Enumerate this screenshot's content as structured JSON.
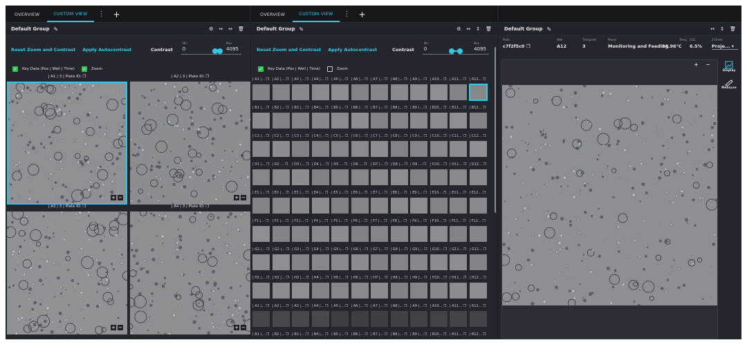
{
  "panels": [
    {
      "tabs": [
        {
          "label": "OVERVIEW"
        },
        {
          "label": "CUSTOM VIEW"
        }
      ],
      "tab_menu": "⋮",
      "tab_add": "+",
      "group_title": "Default Group",
      "reset_label": "Reset Zoom and Contrast",
      "autocontrast_label": "Apply Autocontrast",
      "contrast_label": "Contrast",
      "min_label": "Min",
      "max_label": "Max",
      "min_value": "0",
      "max_value": "4095",
      "key_data_label": "Key Data (Pos | Well | Time)",
      "zoom_label": "Zoom",
      "key_data_checked": true,
      "zoom_checked": true,
      "wells": [
        {
          "label": "| A1 | 3 | Plate ID: ",
          "selected": true
        },
        {
          "label": "| A2 | 3 | Plate ID: ",
          "selected": false
        },
        {
          "label": "| A3 | 3 | Plate ID: ",
          "selected": false
        },
        {
          "label": "| A4 | 3 | Plate ID: ",
          "selected": false
        }
      ],
      "zoom_in": "+",
      "zoom_out": "−"
    },
    {
      "tabs": [
        {
          "label": "OVERVIEW"
        },
        {
          "label": "CUSTOM VIEW"
        }
      ],
      "tab_menu": "⋮",
      "tab_add": "+",
      "group_title": "Default Group",
      "reset_label": "Reset Zoom and Contrast",
      "autocontrast_label": "Apply Autocontrast",
      "contrast_label": "Contrast",
      "min_label": "Min",
      "max_label": "Max",
      "min_value": "0",
      "max_value": "4095",
      "key_data_label": "Key Data (Pos | Well | Time)",
      "zoom_label": "Zoom",
      "key_data_checked": true,
      "zoom_checked": false,
      "rows": [
        {
          "labels": [
            "| A1 |...",
            "| A2 |...",
            "| A3 |...",
            "| A4 |...",
            "| A5 |...",
            "| A6 |...",
            "| A7 |...",
            "| A8 |...",
            "| A9 |...",
            "| A10...",
            "| A11...",
            "| A12..."
          ],
          "dark": false,
          "sel": 11
        },
        {
          "labels": [
            "| B1 |...",
            "| B2 |...",
            "| B3 |...",
            "| B4 |...",
            "| B5 |...",
            "| B6 |...",
            "| B7 |...",
            "| B8 |...",
            "| B9 |...",
            "| B10...",
            "| B11...",
            "| B12..."
          ],
          "dark": false,
          "sel": -1
        },
        {
          "labels": [
            "| C1 |...",
            "| C2 |...",
            "| C3 |...",
            "| C4 |...",
            "| C5 |...",
            "| C6 |...",
            "| C7 |...",
            "| C8 |...",
            "| C9 |...",
            "| C10...",
            "| C11...",
            "| C12..."
          ],
          "dark": false,
          "sel": -1
        },
        {
          "labels": [
            "| D1 |...",
            "| D2 ...",
            "| D3 |...",
            "| D4 |...",
            "| D5 ...",
            "| D6 ...",
            "| D7 |...",
            "| D8 |...",
            "| D9 ...",
            "| D10...",
            "| D11...",
            "| D12..."
          ],
          "dark": false,
          "sel": -1
        },
        {
          "labels": [
            "| E1 |...",
            "| E2 |...",
            "| E3 |...",
            "| E4 |...",
            "| E5 |...",
            "| E6 |...",
            "| E7 |...",
            "| E8 |...",
            "| E9 |...",
            "| E10...",
            "| E11...",
            "| E12..."
          ],
          "dark": false,
          "sel": -1
        },
        {
          "labels": [
            "| F1 |...",
            "| F2 |...",
            "| F3 |...",
            "| F4 |...",
            "| F5 |...",
            "| F6 |...",
            "| F7 |...",
            "| F8 |...",
            "| F9 |...",
            "| F10...",
            "| F11...",
            "| F12..."
          ],
          "dark": false,
          "sel": -1
        },
        {
          "labels": [
            "| G1 |...",
            "| G2 |...",
            "| G3 |...",
            "| G4 |...",
            "| G5 |...",
            "| G6 |...",
            "| G7 |...",
            "| G8 |...",
            "| G9 |...",
            "| G10...",
            "| G11...",
            "| G12..."
          ],
          "dark": false,
          "sel": -1
        },
        {
          "labels": [
            "| H1 |...",
            "| H2 |...",
            "| H3 |...",
            "| H4 |...",
            "| H5 |...",
            "| H6 |...",
            "| H7 |...",
            "| H8 |...",
            "| H9 |...",
            "| H10...",
            "| H11...",
            "| H12..."
          ],
          "dark": false,
          "sel": -1
        },
        {
          "labels": [
            "| A1 |...",
            "| A2 |...",
            "| A3 |...",
            "| A4 |...",
            "| A5 |...",
            "| A6 |...",
            "| A7 |...",
            "| A8 |...",
            "| A9 |...",
            "| A10...",
            "| A11...",
            "| A12..."
          ],
          "dark": true,
          "sel": -1
        },
        {
          "labels": [
            "| B1 |...",
            "| B2 |...",
            "| B3 |...",
            "| B4 |...",
            "| B5 |...",
            "| B6 |...",
            "| B7 |...",
            "| B8 |...",
            "| B9 |...",
            "| B10...",
            "| B11...",
            "| B12..."
          ],
          "dark": true,
          "sel": -1
        }
      ]
    },
    {
      "group_title": "Default Group",
      "meta": [
        {
          "key": "Plate",
          "value": "c7f2f5c0"
        },
        {
          "key": "Well",
          "value": "A12"
        },
        {
          "key": "Timepoint",
          "value": "3"
        },
        {
          "key": "Phase",
          "value": "Monitoring and Feeding"
        },
        {
          "key": "Temp",
          "value": "36.96°C"
        },
        {
          "key": "CO2",
          "value": "6.5%"
        },
        {
          "key": "Z-Order",
          "value": "Proje..."
        }
      ],
      "display_label": "Display",
      "measure_label": "Measure"
    }
  ],
  "colors": {
    "accent": "#34c6e6",
    "check": "#35c25a"
  },
  "icons": [
    "pencil-icon",
    "gear-icon",
    "collapse-icon",
    "expand-icon",
    "trash-icon",
    "copy-icon",
    "display-icon",
    "measure-icon",
    "kebab-icon",
    "plus-icon"
  ]
}
